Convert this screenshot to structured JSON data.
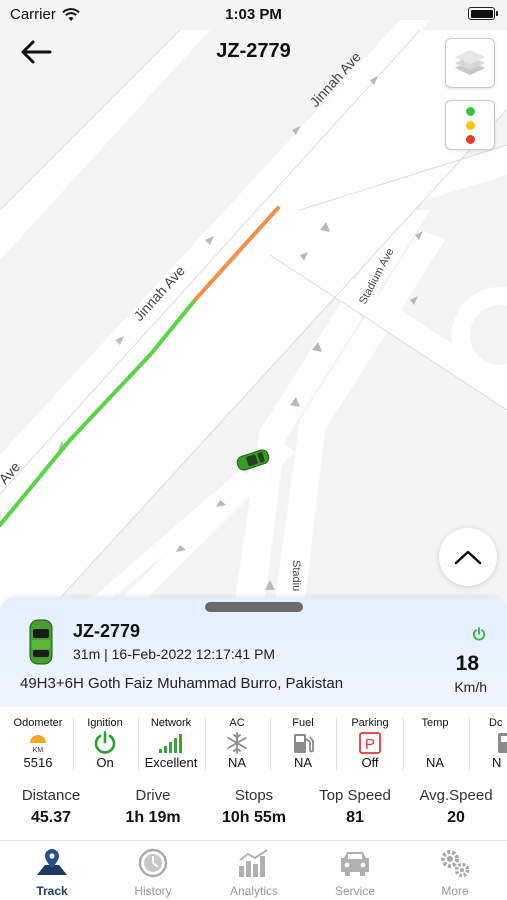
{
  "status_bar": {
    "carrier": "Carrier",
    "time": "1:03 PM"
  },
  "header": {
    "title": "JZ-2779",
    "back_icon": "arrow-left-icon"
  },
  "map": {
    "road_labels": [
      "Jinnah Ave",
      "Jinnah Ave",
      "Stadium Ave",
      "Stadium Ave",
      "Stadiu",
      "Ave"
    ],
    "route_colors": {
      "traveled": "#5cd14a",
      "recent": "#f0904a"
    },
    "vehicle_color": "#3c9a2b",
    "traffic_colors": [
      "#3cc23c",
      "#f5c518",
      "#e43b2f"
    ]
  },
  "vehicle": {
    "name": "JZ-2779",
    "meta": "31m  | 16-Feb-2022 12:17:41 PM",
    "address": "49H3+6H Goth Faiz Muhammad Burro, Pakistan",
    "speed": "18",
    "speed_unit": "Km/h",
    "power_color": "#3cb043"
  },
  "sensors": [
    {
      "label": "Odometer",
      "icon": "odometer-icon",
      "value": "5516"
    },
    {
      "label": "Ignition",
      "icon": "power-icon",
      "value": "On"
    },
    {
      "label": "Network",
      "icon": "signal-bars-icon",
      "value": "Excellent"
    },
    {
      "label": "AC",
      "icon": "snowflake-icon",
      "value": "NA"
    },
    {
      "label": "Fuel",
      "icon": "fuel-pump-icon",
      "value": "NA"
    },
    {
      "label": "Parking",
      "icon": "parking-icon",
      "value": "Off"
    },
    {
      "label": "Temp",
      "icon": "temperature-icon",
      "value": "NA"
    },
    {
      "label": "Dc",
      "icon": "door-icon",
      "value": "N"
    }
  ],
  "stats": [
    {
      "label": "Distance",
      "value": "45.37"
    },
    {
      "label": "Drive",
      "value": "1h 19m"
    },
    {
      "label": "Stops",
      "value": "10h 55m"
    },
    {
      "label": "Top Speed",
      "value": "81"
    },
    {
      "label": "Avg.Speed",
      "value": "20"
    }
  ],
  "tabs": [
    {
      "label": "Track",
      "icon": "map-pin-icon",
      "active": true
    },
    {
      "label": "History",
      "icon": "history-clock-icon",
      "active": false
    },
    {
      "label": "Analytics",
      "icon": "bar-chart-icon",
      "active": false
    },
    {
      "label": "Service",
      "icon": "car-service-icon",
      "active": false
    },
    {
      "label": "More",
      "icon": "gears-icon",
      "active": false
    }
  ]
}
